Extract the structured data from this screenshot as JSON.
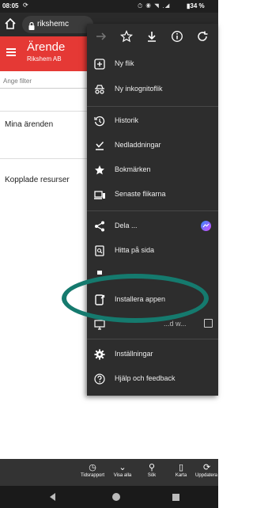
{
  "status_bar": {
    "time": "08:05",
    "sync_icon": "sync-icon",
    "system_icons": "⏱ ◉ ◥ .◢",
    "battery": "▮34 %"
  },
  "browser": {
    "url": "rikshemc",
    "home_icon": "home-icon",
    "lock_icon": "lock-icon"
  },
  "page": {
    "title": "Ärende",
    "subtitle": "Rikshem AB",
    "filter_placeholder": "Ange filter",
    "section1": "Mina ärenden",
    "section2": "Kopplade resurser",
    "accent": "#e53935"
  },
  "menu": {
    "top_icons": [
      "forward-arrow-icon",
      "star-icon",
      "download-icon",
      "info-icon",
      "refresh-icon"
    ],
    "items": [
      {
        "label": "Ny flik",
        "icon": "new-tab-icon"
      },
      {
        "label": "Ny inkognitoflik",
        "icon": "incognito-icon"
      },
      {
        "label": "Historik",
        "icon": "history-icon"
      },
      {
        "label": "Nedladdningar",
        "icon": "downloads-icon"
      },
      {
        "label": "Bokmärken",
        "icon": "bookmarks-star-icon"
      },
      {
        "label": "Senaste flikarna",
        "icon": "recent-tabs-icon"
      },
      {
        "label": "Dela ...",
        "icon": "share-icon"
      },
      {
        "label": "Hitta på sida",
        "icon": "find-in-page-icon"
      },
      {
        "label": "Installera appen",
        "icon": "install-app-icon"
      },
      {
        "label": "Inställningar",
        "icon": "settings-gear-icon"
      },
      {
        "label": "Hjälp och feedback",
        "icon": "help-icon"
      }
    ],
    "partial_item_text": "...d w...",
    "background": "#2d2d2d"
  },
  "bottom_tabs": [
    {
      "label": "Tidsrapport",
      "icon": "clock-icon"
    },
    {
      "label": "Visa alla",
      "icon": "chevron-down-icon"
    },
    {
      "label": "Sök",
      "icon": "search-icon"
    },
    {
      "label": "Karta",
      "icon": "map-icon"
    },
    {
      "label": "Uppdatera",
      "icon": "refresh-icon"
    }
  ],
  "annotation_color": "#157a6e"
}
